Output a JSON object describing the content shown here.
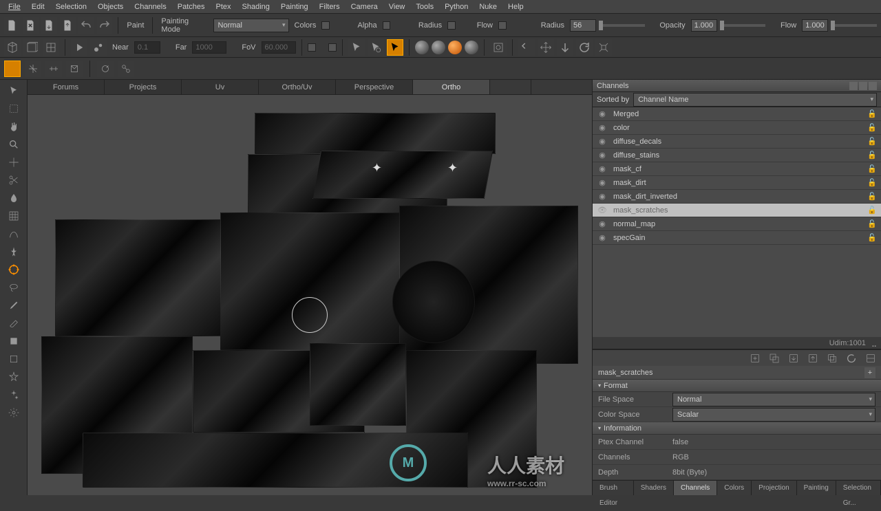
{
  "menu": [
    "File",
    "Edit",
    "Selection",
    "Objects",
    "Channels",
    "Patches",
    "Ptex",
    "Shading",
    "Painting",
    "Filters",
    "Camera",
    "View",
    "Tools",
    "Python",
    "Nuke",
    "Help"
  ],
  "paint_toolbar": {
    "paint_label": "Paint",
    "mode_label": "Painting Mode",
    "mode_value": "Normal",
    "colors_label": "Colors",
    "alpha_label": "Alpha",
    "radius_label": "Radius",
    "flow_label": "Flow",
    "radius2_label": "Radius",
    "radius2_value": "56",
    "opacity_label": "Opacity",
    "opacity_value": "1.000",
    "flow2_label": "Flow",
    "flow2_value": "1.000"
  },
  "cam_toolbar": {
    "near_label": "Near",
    "near_value": "0.1",
    "far_label": "Far",
    "far_value": "1000",
    "fov_label": "FoV",
    "fov_value": "60.000"
  },
  "view_tabs": [
    "Forums",
    "Projects",
    "Uv",
    "Ortho/Uv",
    "Perspective",
    "Ortho"
  ],
  "view_active": "Ortho",
  "watermark_text": "人人素材",
  "watermark_url": "www.rr-sc.com",
  "channels_panel": {
    "title": "Channels",
    "sorted_by_label": "Sorted by",
    "sorted_by_value": "Channel Name",
    "items": [
      "Merged",
      "color",
      "diffuse_decals",
      "diffuse_stains",
      "mask_cf",
      "mask_dirt",
      "mask_dirt_inverted",
      "mask_scratches",
      "normal_map",
      "specGain"
    ],
    "selected": "mask_scratches",
    "udim_label": "Udim:1001"
  },
  "properties": {
    "title": "mask_scratches",
    "s1": "Format",
    "filespace_label": "File Space",
    "filespace_value": "Normal",
    "colorspace_label": "Color Space",
    "colorspace_value": "Scalar",
    "s2": "Information",
    "ptex_label": "Ptex Channel",
    "ptex_value": "false",
    "channels_label": "Channels",
    "channels_value": "RGB",
    "depth_label": "Depth",
    "depth_value": "8bit  (Byte)"
  },
  "bottom_tabs": [
    "Brush Editor",
    "Shaders",
    "Channels",
    "Colors",
    "Projection",
    "Painting",
    "Selection Gr..."
  ],
  "bottom_active": "Channels"
}
